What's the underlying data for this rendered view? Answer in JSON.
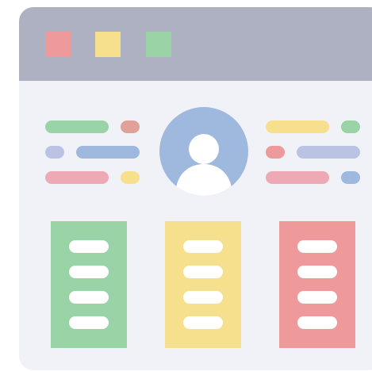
{
  "colors": {
    "background": "#ffffff",
    "window": "#f1f2f7",
    "titlebar": "#adb1c1",
    "red": "#ef9a9a",
    "yellow": "#f6df8d",
    "green": "#99d3a6",
    "blue": "#9fb8de",
    "lavender": "#bbc3e5",
    "salmon": "#e1a19a",
    "pink": "#eeaab4",
    "white": "#ffffff"
  },
  "icons": {
    "window_dots": [
      "red-square",
      "yellow-square",
      "green-square"
    ],
    "avatar": "user-avatar-icon"
  },
  "cards": [
    "green-card",
    "yellow-card",
    "red-card"
  ]
}
